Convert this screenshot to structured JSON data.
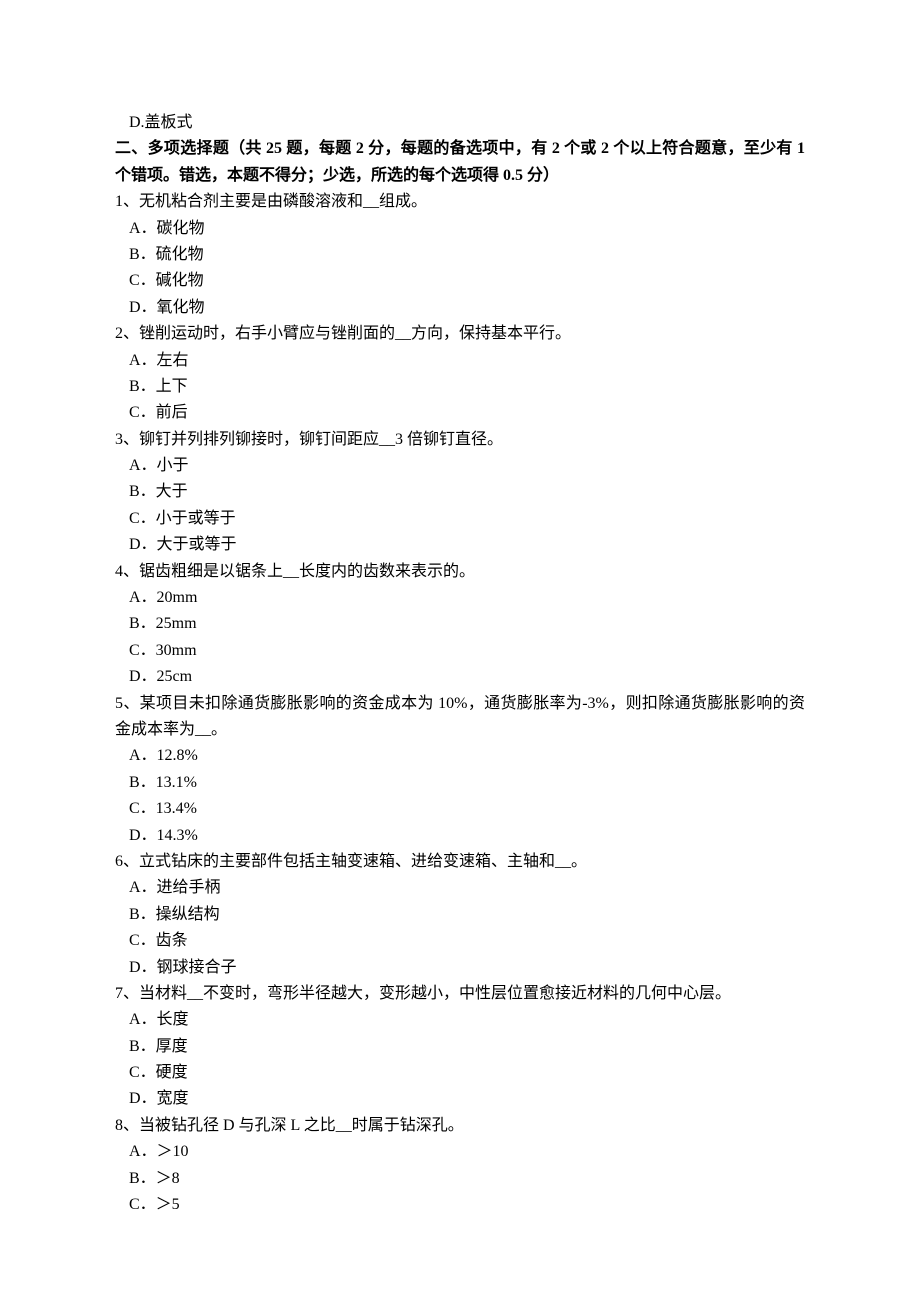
{
  "prevOptionD": "D.盖板式",
  "sectionHeader": "二、多项选择题（共 25 题，每题 2 分，每题的备选项中，有 2 个或 2 个以上符合题意，至少有 1 个错项。错选，本题不得分；少选，所选的每个选项得 0.5 分）",
  "questions": [
    {
      "num": "1",
      "text": "、无机粘合剂主要是由磷酸溶液和__组成。",
      "options": [
        "A．碳化物",
        "B．硫化物",
        "C．碱化物",
        "D．氧化物"
      ]
    },
    {
      "num": "2",
      "text": "、锉削运动时，右手小臂应与锉削面的__方向，保持基本平行。",
      "options": [
        "A．左右",
        "B．上下",
        "C．前后"
      ]
    },
    {
      "num": "3",
      "text": "、铆钉并列排列铆接时，铆钉间距应__3 倍铆钉直径。",
      "options": [
        "A．小于",
        "B．大于",
        "C．小于或等于",
        "D．大于或等于"
      ]
    },
    {
      "num": "4",
      "text": "、锯齿粗细是以锯条上__长度内的齿数来表示的。",
      "options": [
        "A．20mm",
        "B．25mm",
        "C．30mm",
        "D．25cm"
      ]
    },
    {
      "num": "5",
      "text": "、某项目未扣除通货膨胀影响的资金成本为 10%，通货膨胀率为-3%，则扣除通货膨胀影响的资金成本率为__。",
      "options": [
        "A．12.8%",
        "B．13.1%",
        "C．13.4%",
        "D．14.3%"
      ]
    },
    {
      "num": "6",
      "text": "、立式钻床的主要部件包括主轴变速箱、进给变速箱、主轴和__。",
      "options": [
        "A．进给手柄",
        "B．操纵结构",
        "C．齿条",
        "D．钢球接合子"
      ]
    },
    {
      "num": "7",
      "text": "、当材料__不变时，弯形半径越大，变形越小，中性层位置愈接近材料的几何中心层。",
      "options": [
        "A．长度",
        "B．厚度",
        "C．硬度",
        "D．宽度"
      ]
    },
    {
      "num": "8",
      "text": "、当被钻孔径 D 与孔深 L 之比__时属于钻深孔。",
      "options": [
        "A．＞10",
        "B．＞8",
        "C．＞5"
      ]
    }
  ]
}
